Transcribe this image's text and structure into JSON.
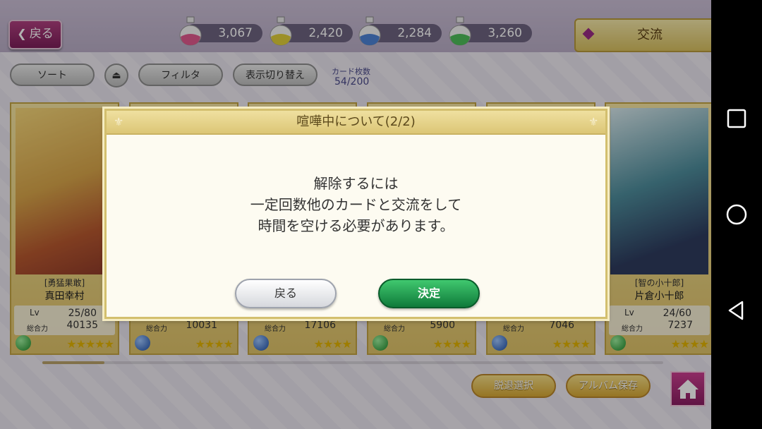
{
  "header": {
    "back_label": "戻る",
    "currencies": [
      {
        "icon": "pink-potion-icon",
        "value": "3,067",
        "color": "#e15a8f"
      },
      {
        "icon": "yellow-potion-icon",
        "value": "2,420",
        "color": "#e0cf3a"
      },
      {
        "icon": "blue-potion-icon",
        "value": "2,284",
        "color": "#4d83d6"
      },
      {
        "icon": "green-potion-icon",
        "value": "3,260",
        "color": "#4ebd5a"
      }
    ],
    "koryu_label": "交流"
  },
  "toolbar": {
    "sort_label": "ソート",
    "filter_label": "フィルタ",
    "display_toggle_label": "表示切り替え",
    "card_count_label": "カード枚数",
    "card_count_value": "54/200"
  },
  "cards": [
    {
      "rank": "[勇猛果敢]",
      "name": "真田幸村",
      "lv_label": "Lv",
      "lv": "25/80",
      "power_label": "総合力",
      "power": "40135",
      "stars": "★★★★★"
    },
    {
      "power_label": "総合力",
      "power": "10031",
      "stars": "★★★★"
    },
    {
      "power_label": "総合力",
      "power": "17106",
      "stars": "★★★★"
    },
    {
      "power_label": "総合力",
      "power": "5900",
      "stars": "★★★★"
    },
    {
      "power_label": "総合力",
      "power": "7046",
      "stars": "★★★★"
    },
    {
      "rank": "[智の小十郎]",
      "name": "片倉小十郎",
      "lv_label": "Lv",
      "lv": "24/60",
      "power_label": "総合力",
      "power": "7237",
      "stars": "★★★★"
    }
  ],
  "footer": {
    "retire_label": "脱退選択",
    "album_label": "アルバム保存"
  },
  "dialog": {
    "title": "喧嘩中について(2/2)",
    "line1": "解除するには",
    "line2": "一定回数他のカードと交流をして",
    "line3": "時間を空ける必要があります。",
    "back_label": "戻る",
    "ok_label": "決定"
  }
}
